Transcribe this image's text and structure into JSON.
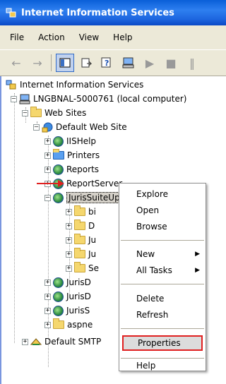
{
  "window": {
    "title": "Internet Information Services"
  },
  "menu": [
    "File",
    "Action",
    "View",
    "Help"
  ],
  "toolbar": {
    "buttons": [
      "back-arrow-icon",
      "forward-arrow-icon",
      "show-hide-tree-icon",
      "export-list-icon",
      "help-icon",
      "computer-icon",
      "play-icon",
      "stop-icon",
      "pause-icon"
    ]
  },
  "tree": {
    "root": "Internet Information Services",
    "computer": "LNGBNAL-5000761 (local computer)",
    "web_sites": "Web Sites",
    "default_site": "Default Web Site",
    "children": [
      "IISHelp",
      "Printers",
      "Reports",
      "ReportServer",
      "JurisSuiteUpdater"
    ],
    "sub_children": [
      "bi",
      "D",
      "Ju",
      "Ju",
      "Se"
    ],
    "more_children": [
      "JurisD",
      "JurisD",
      "JurisS",
      "aspne"
    ],
    "smtp": "Default SMTP"
  },
  "context_menu": {
    "items": [
      "Explore",
      "Open",
      "Browse",
      "New",
      "All Tasks",
      "Delete",
      "Refresh",
      "Properties",
      "Help"
    ],
    "highlighted": "Properties"
  },
  "colors": {
    "accent": "#316ac5",
    "highlight_border": "#e02020",
    "arrow": "#e02020"
  }
}
